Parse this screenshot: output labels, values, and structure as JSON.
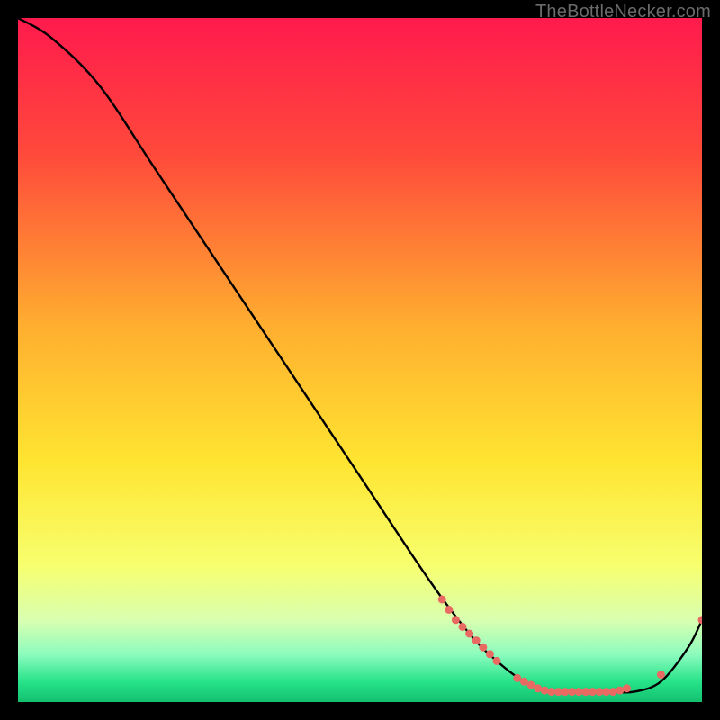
{
  "watermark": "TheBottleNecker.com",
  "chart_data": {
    "type": "line",
    "title": "",
    "xlabel": "",
    "ylabel": "",
    "xlim": [
      0,
      100
    ],
    "ylim": [
      0,
      100
    ],
    "grid": false,
    "background_gradient": {
      "stops": [
        {
          "offset": 0.0,
          "color": "#ff1a4d"
        },
        {
          "offset": 0.2,
          "color": "#ff4a3b"
        },
        {
          "offset": 0.45,
          "color": "#ffae2f"
        },
        {
          "offset": 0.65,
          "color": "#ffe531"
        },
        {
          "offset": 0.8,
          "color": "#f7ff6e"
        },
        {
          "offset": 0.88,
          "color": "#d9ffb0"
        },
        {
          "offset": 0.93,
          "color": "#8dfcbe"
        },
        {
          "offset": 0.97,
          "color": "#27e38a"
        },
        {
          "offset": 1.0,
          "color": "#13c06e"
        }
      ]
    },
    "series": [
      {
        "name": "curve",
        "color": "#000000",
        "x": [
          0,
          5,
          12,
          20,
          30,
          40,
          50,
          60,
          66,
          70,
          74,
          78,
          82,
          86,
          90,
          94,
          98,
          100
        ],
        "y": [
          100,
          97,
          90,
          78,
          63,
          48,
          33,
          18,
          10,
          6,
          3,
          1.5,
          1.5,
          1.5,
          1.5,
          3,
          8,
          12
        ]
      }
    ],
    "markers": {
      "color": "#e96a63",
      "radius": 4.5,
      "points": [
        {
          "x": 62,
          "y": 15
        },
        {
          "x": 63,
          "y": 13.5
        },
        {
          "x": 64,
          "y": 12
        },
        {
          "x": 65,
          "y": 11
        },
        {
          "x": 66,
          "y": 10
        },
        {
          "x": 67,
          "y": 9
        },
        {
          "x": 68,
          "y": 8
        },
        {
          "x": 69,
          "y": 7
        },
        {
          "x": 70,
          "y": 6
        },
        {
          "x": 73,
          "y": 3.5
        },
        {
          "x": 74,
          "y": 3
        },
        {
          "x": 75,
          "y": 2.5
        },
        {
          "x": 76,
          "y": 2
        },
        {
          "x": 77,
          "y": 1.7
        },
        {
          "x": 78,
          "y": 1.5
        },
        {
          "x": 79,
          "y": 1.5
        },
        {
          "x": 80,
          "y": 1.5
        },
        {
          "x": 81,
          "y": 1.5
        },
        {
          "x": 82,
          "y": 1.5
        },
        {
          "x": 83,
          "y": 1.5
        },
        {
          "x": 84,
          "y": 1.5
        },
        {
          "x": 85,
          "y": 1.5
        },
        {
          "x": 86,
          "y": 1.5
        },
        {
          "x": 87,
          "y": 1.5
        },
        {
          "x": 88,
          "y": 1.7
        },
        {
          "x": 89,
          "y": 2
        },
        {
          "x": 94,
          "y": 4
        },
        {
          "x": 100,
          "y": 12
        }
      ]
    }
  }
}
